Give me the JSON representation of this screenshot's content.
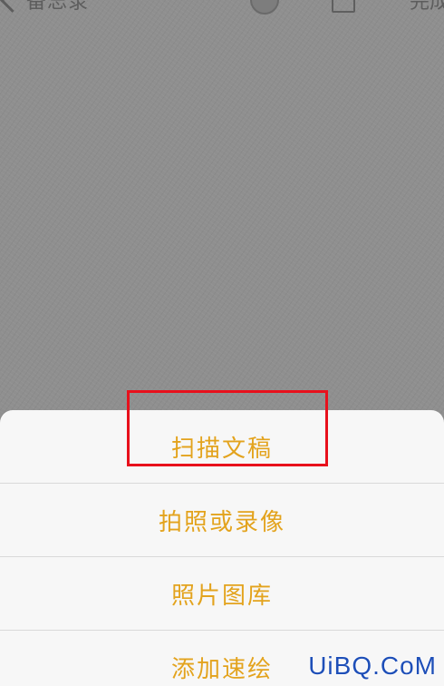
{
  "nav": {
    "back_label": "备忘录",
    "done_label": "完成"
  },
  "sheet": {
    "items": [
      {
        "label": "扫描文稿"
      },
      {
        "label": "拍照或录像"
      },
      {
        "label": "照片图库"
      },
      {
        "label": "添加速绘"
      }
    ]
  },
  "watermark": "UiBQ.CoM",
  "colors": {
    "accent": "#e3a31d",
    "highlight": "#e8101c",
    "dim_background": "#8f8f8f"
  }
}
